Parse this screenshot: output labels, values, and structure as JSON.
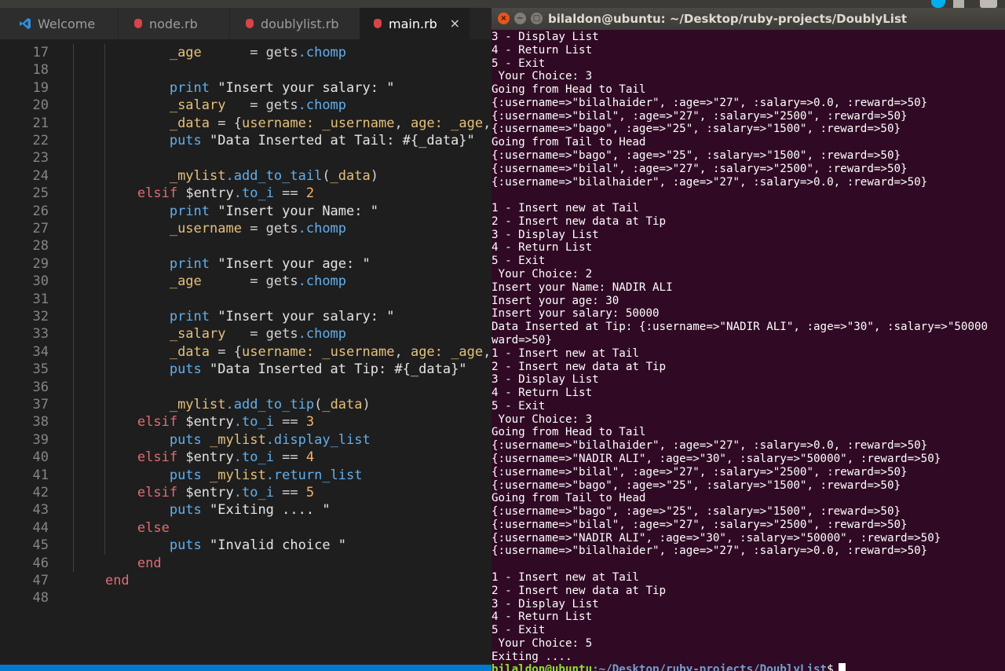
{
  "editor": {
    "tabs": [
      {
        "label": "Welcome"
      },
      {
        "label": "node.rb"
      },
      {
        "label": "doublylist.rb"
      },
      {
        "label": "main.rb"
      }
    ],
    "close_glyph": "×",
    "code_lines": [
      {
        "n": "17",
        "t": "            _age      = gets.chomp"
      },
      {
        "n": "18",
        "t": ""
      },
      {
        "n": "19",
        "t": "            print \"Insert your salary: \""
      },
      {
        "n": "20",
        "t": "            _salary   = gets.chomp"
      },
      {
        "n": "21",
        "t": "            _data = {username: _username, age: _age, sala"
      },
      {
        "n": "22",
        "t": "            puts \"Data Inserted at Tail: #{_data}\""
      },
      {
        "n": "23",
        "t": ""
      },
      {
        "n": "24",
        "t": "            _mylist.add_to_tail(_data)"
      },
      {
        "n": "25",
        "t": "        elsif $entry.to_i == 2"
      },
      {
        "n": "26",
        "t": "            print \"Insert your Name: \""
      },
      {
        "n": "27",
        "t": "            _username = gets.chomp"
      },
      {
        "n": "28",
        "t": ""
      },
      {
        "n": "29",
        "t": "            print \"Insert your age: \""
      },
      {
        "n": "30",
        "t": "            _age      = gets.chomp"
      },
      {
        "n": "31",
        "t": ""
      },
      {
        "n": "32",
        "t": "            print \"Insert your salary: \""
      },
      {
        "n": "33",
        "t": "            _salary   = gets.chomp"
      },
      {
        "n": "34",
        "t": "            _data = {username: _username, age: _age, sala"
      },
      {
        "n": "35",
        "t": "            puts \"Data Inserted at Tip: #{_data}\""
      },
      {
        "n": "36",
        "t": ""
      },
      {
        "n": "37",
        "t": "            _mylist.add_to_tip(_data)"
      },
      {
        "n": "38",
        "t": "        elsif $entry.to_i == 3"
      },
      {
        "n": "39",
        "t": "            puts _mylist.display_list"
      },
      {
        "n": "40",
        "t": "        elsif $entry.to_i == 4"
      },
      {
        "n": "41",
        "t": "            puts _mylist.return_list"
      },
      {
        "n": "42",
        "t": "        elsif $entry.to_i == 5"
      },
      {
        "n": "43",
        "t": "            puts \"Exiting .... \""
      },
      {
        "n": "44",
        "t": "        else"
      },
      {
        "n": "45",
        "t": "            puts \"Invalid choice \""
      },
      {
        "n": "46",
        "t": "        end"
      },
      {
        "n": "47",
        "t": "    end"
      },
      {
        "n": "48",
        "t": ""
      }
    ]
  },
  "terminal": {
    "title": "bilaldon@ubuntu: ~/Desktop/ruby-projects/DoublyList",
    "window_buttons": {
      "close": "×",
      "minimize": "−",
      "maximize": "□"
    },
    "lines": [
      "3 - Display List",
      "4 - Return List",
      "5 - Exit",
      " Your Choice: 3",
      "Going from Head to Tail",
      "{:username=>\"bilalhaider\", :age=>\"27\", :salary=>0.0, :reward=>50}",
      "{:username=>\"bilal\", :age=>\"27\", :salary=>\"2500\", :reward=>50}",
      "{:username=>\"bago\", :age=>\"25\", :salary=>\"1500\", :reward=>50}",
      "Going from Tail to Head",
      "{:username=>\"bago\", :age=>\"25\", :salary=>\"1500\", :reward=>50}",
      "{:username=>\"bilal\", :age=>\"27\", :salary=>\"2500\", :reward=>50}",
      "{:username=>\"bilalhaider\", :age=>\"27\", :salary=>0.0, :reward=>50}",
      "",
      "1 - Insert new at Tail",
      "2 - Insert new data at Tip",
      "3 - Display List",
      "4 - Return List",
      "5 - Exit",
      " Your Choice: 2",
      "Insert your Name: NADIR ALI",
      "Insert your age: 30",
      "Insert your salary: 50000",
      "Data Inserted at Tip: {:username=>\"NADIR ALI\", :age=>\"30\", :salary=>\"50000",
      "ward=>50}",
      "1 - Insert new at Tail",
      "2 - Insert new data at Tip",
      "3 - Display List",
      "4 - Return List",
      "5 - Exit",
      " Your Choice: 3",
      "Going from Head to Tail",
      "{:username=>\"bilalhaider\", :age=>\"27\", :salary=>0.0, :reward=>50}",
      "{:username=>\"NADIR ALI\", :age=>\"30\", :salary=>\"50000\", :reward=>50}",
      "{:username=>\"bilal\", :age=>\"27\", :salary=>\"2500\", :reward=>50}",
      "{:username=>\"bago\", :age=>\"25\", :salary=>\"1500\", :reward=>50}",
      "Going from Tail to Head",
      "{:username=>\"bago\", :age=>\"25\", :salary=>\"1500\", :reward=>50}",
      "{:username=>\"bilal\", :age=>\"27\", :salary=>\"2500\", :reward=>50}",
      "{:username=>\"NADIR ALI\", :age=>\"30\", :salary=>\"50000\", :reward=>50}",
      "{:username=>\"bilalhaider\", :age=>\"27\", :salary=>0.0, :reward=>50}",
      "",
      "1 - Insert new at Tail",
      "2 - Insert new data at Tip",
      "3 - Display List",
      "4 - Return List",
      "5 - Exit",
      " Your Choice: 5",
      "Exiting ...."
    ],
    "prompt": {
      "user": "bilaldon@ubuntu",
      "path": ":~/Desktop/ruby-projects/DoublyList",
      "symbol": "$"
    }
  },
  "colors": {
    "terminal_bg": "#300a24",
    "editor_bg": "#1e1e1e",
    "statusbar": "#007acc",
    "file_dot": "#d9434a",
    "prompt_user": "#8ae234",
    "prompt_path": "#729fcf"
  }
}
